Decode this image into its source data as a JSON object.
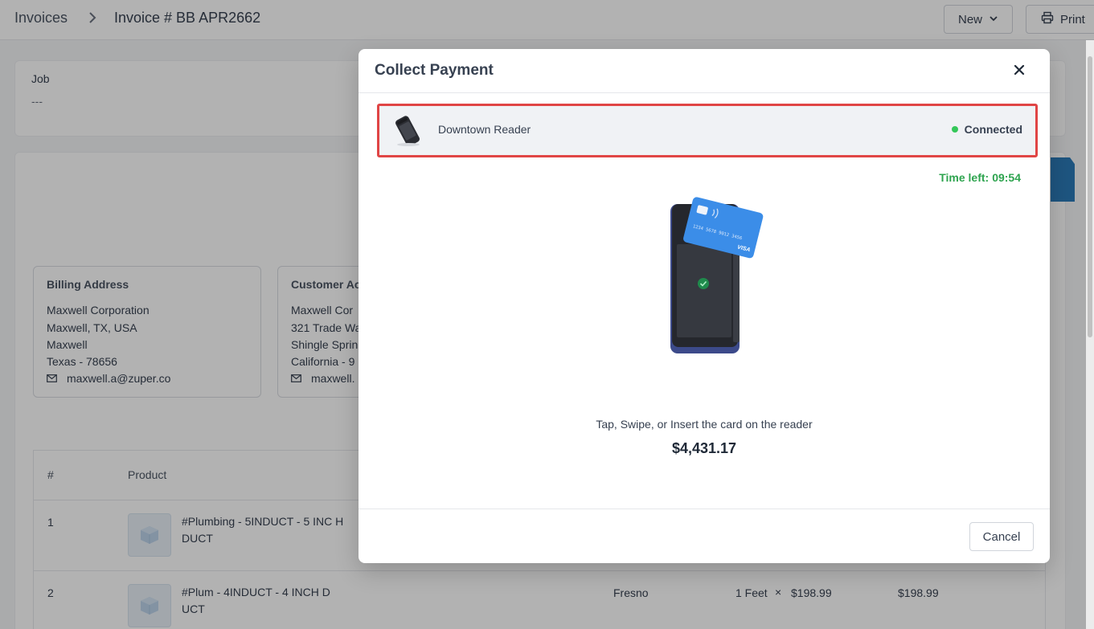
{
  "header": {
    "breadcrumb_root": "Invoices",
    "breadcrumb_current": "Invoice # BB APR2662",
    "new_label": "New",
    "print_label": "Print"
  },
  "job": {
    "label": "Job",
    "value": "---"
  },
  "billing": {
    "title": "Billing Address",
    "lines": [
      "Maxwell Corporation",
      "Maxwell, TX, USA",
      "Maxwell",
      "Texas - 78656"
    ],
    "email": "maxwell.a@zuper.co"
  },
  "customer": {
    "title": "Customer Ac",
    "lines": [
      "Maxwell Cor",
      "321 Trade Wa",
      "Shingle Sprin",
      "California - 9"
    ],
    "email": "maxwell."
  },
  "table": {
    "headers": {
      "num": "#",
      "product": "Product"
    },
    "rows": [
      {
        "num": "1",
        "product": "#Plumbing - 5INDUCT - 5 INC H DUCT"
      },
      {
        "num": "2",
        "product": "#Plum - 4INDUCT - 4 INCH D UCT",
        "location": "Fresno",
        "qty": "1 Feet",
        "times": "×",
        "unit_price": "$198.99",
        "total": "$198.99"
      }
    ]
  },
  "modal": {
    "title": "Collect Payment",
    "reader_name": "Downtown Reader",
    "reader_status": "Connected",
    "time_left_label": "Time left:",
    "time_left_value": "09:54",
    "card_number_text": "1234  5678  9012  3456",
    "card_brand": "VISA",
    "instruction": "Tap, Swipe, or Insert the card on the reader",
    "amount": "$4,431.17",
    "cancel_label": "Cancel"
  },
  "colors": {
    "highlight_border": "#e04545",
    "connected_dot": "#34c759",
    "timer_green": "#2ea44f",
    "card_blue": "#3b8de8"
  }
}
